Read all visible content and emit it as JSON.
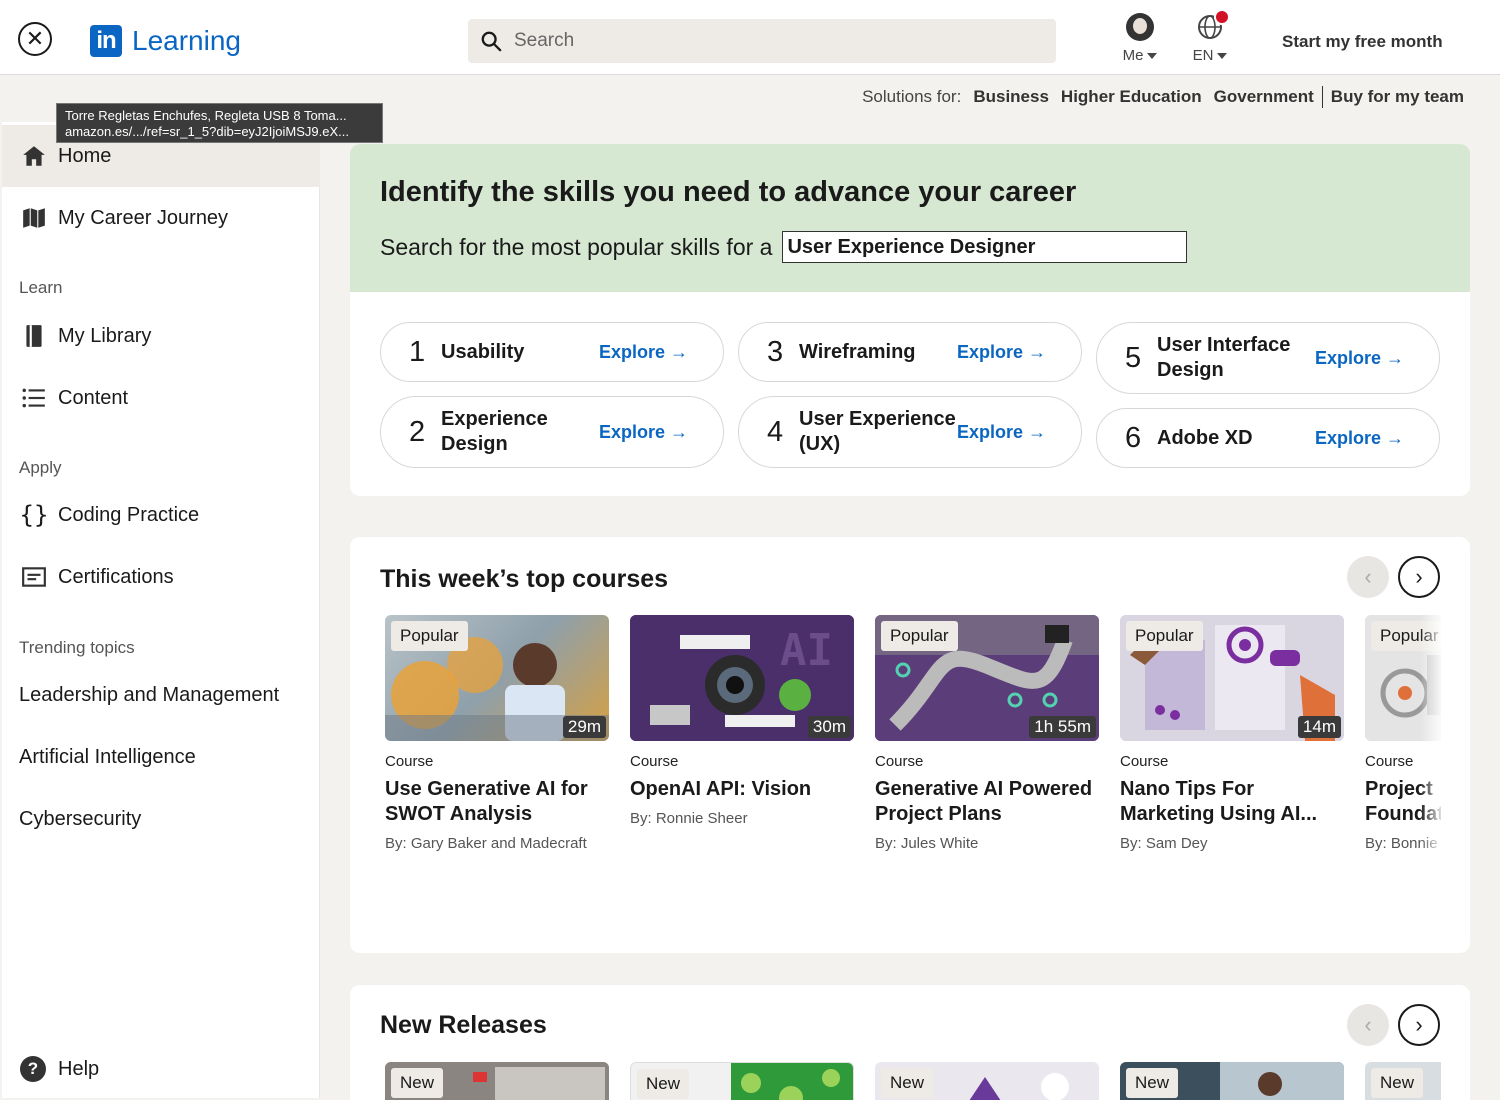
{
  "header": {
    "logo_text": "Learning",
    "logo_mark": "in",
    "search_placeholder": "Search",
    "me_label": "Me",
    "lang_label": "EN",
    "free_month": "Start my free month"
  },
  "solutions": {
    "label": "Solutions for:",
    "items": [
      "Business",
      "Higher Education",
      "Government",
      "Buy for my team"
    ]
  },
  "tooltip": {
    "line1": "Torre Regletas Enchufes, Regleta USB 8 Toma...",
    "line2": "amazon.es/.../ref=sr_1_5?dib=eyJ2IjoiMSJ9.eX..."
  },
  "sidebar": {
    "home": "Home",
    "career": "My Career Journey",
    "learn_label": "Learn",
    "library": "My Library",
    "content": "Content",
    "apply_label": "Apply",
    "coding": "Coding Practice",
    "certs": "Certifications",
    "trending_label": "Trending topics",
    "topics": [
      "Leadership and Management",
      "Artificial Intelligence",
      "Cybersecurity"
    ],
    "help": "Help"
  },
  "skills": {
    "title": "Identify the skills you need to advance your career",
    "prompt": "Search for the most popular skills for a",
    "role": "User Experience Designer",
    "explore": "Explore →",
    "items": [
      {
        "num": "1",
        "name": "Usability"
      },
      {
        "num": "2",
        "name": "Experience Design"
      },
      {
        "num": "3",
        "name": "Wireframing"
      },
      {
        "num": "4",
        "name": "User Experience (UX)"
      },
      {
        "num": "5",
        "name": "User Interface Design"
      },
      {
        "num": "6",
        "name": "Adobe XD"
      }
    ]
  },
  "top_courses": {
    "title": "This week’s top courses",
    "items": [
      {
        "badge": "Popular",
        "duration": "29m",
        "type": "Course",
        "title": "Use Generative AI for SWOT Analysis",
        "author": "By: Gary Baker and Madecraft"
      },
      {
        "badge": "",
        "duration": "30m",
        "type": "Course",
        "title": "OpenAI API: Vision",
        "author": "By: Ronnie Sheer"
      },
      {
        "badge": "Popular",
        "duration": "1h 55m",
        "type": "Course",
        "title": "Generative AI Powered Project Plans",
        "author": "By: Jules White"
      },
      {
        "badge": "Popular",
        "duration": "14m",
        "type": "Course",
        "title": "Nano Tips For Marketing Using AI...",
        "author": "By: Sam Dey"
      },
      {
        "badge": "Popular",
        "duration": "",
        "type": "Course",
        "title": "Project Foundat",
        "author": "By: Bonnie"
      }
    ]
  },
  "new_releases": {
    "title": "New Releases",
    "badge": "New"
  },
  "arrows": {
    "prev": "‹",
    "next": "›"
  }
}
